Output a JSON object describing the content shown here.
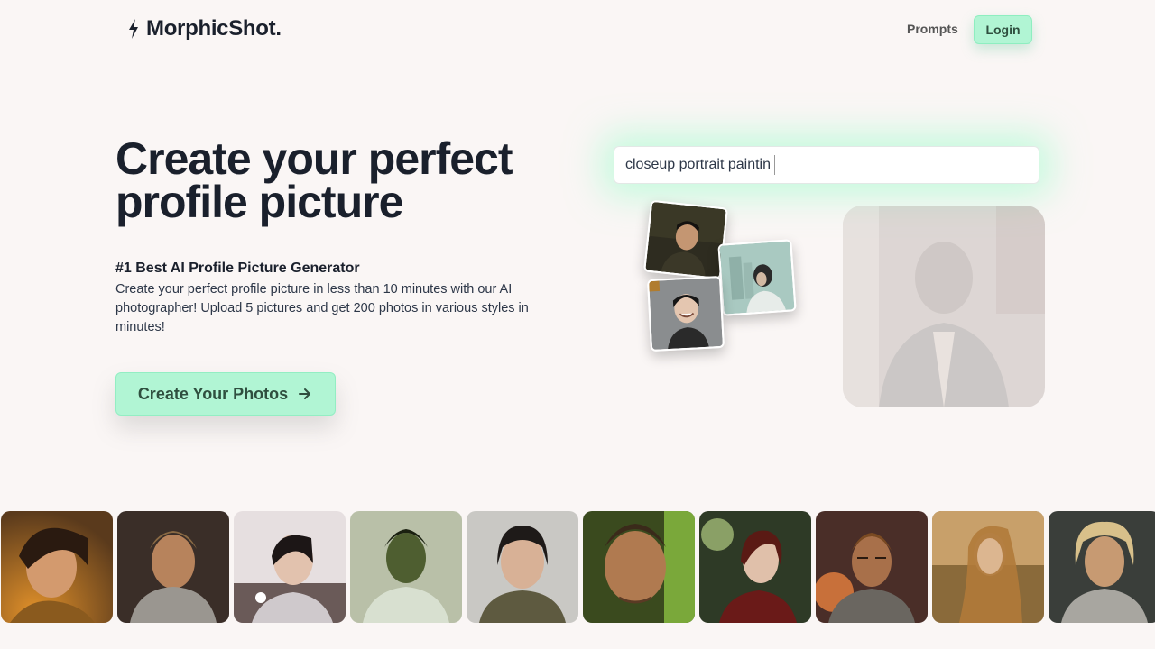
{
  "header": {
    "brand": "MorphicShot.",
    "nav_prompts": "Prompts",
    "login_label": "Login"
  },
  "hero": {
    "title": "Create your perfect profile picture",
    "subtitle": "#1 Best AI Profile Picture Generator",
    "description": "Create your perfect profile picture in less than 10 minutes with our AI photographer! Upload 5 pictures and get 200 photos in various styles in minutes!",
    "cta_label": "Create Your Photos"
  },
  "demo": {
    "prompt_text": "closeup portrait paintin"
  },
  "icons": [
    "lightning-icon",
    "arrow-right-icon"
  ],
  "colors": {
    "background": "#faf6f5",
    "accent": "#b1f5d4",
    "accent_text": "#2f4f3f",
    "heading": "#1a202c"
  },
  "gallery": {
    "count": 10
  }
}
